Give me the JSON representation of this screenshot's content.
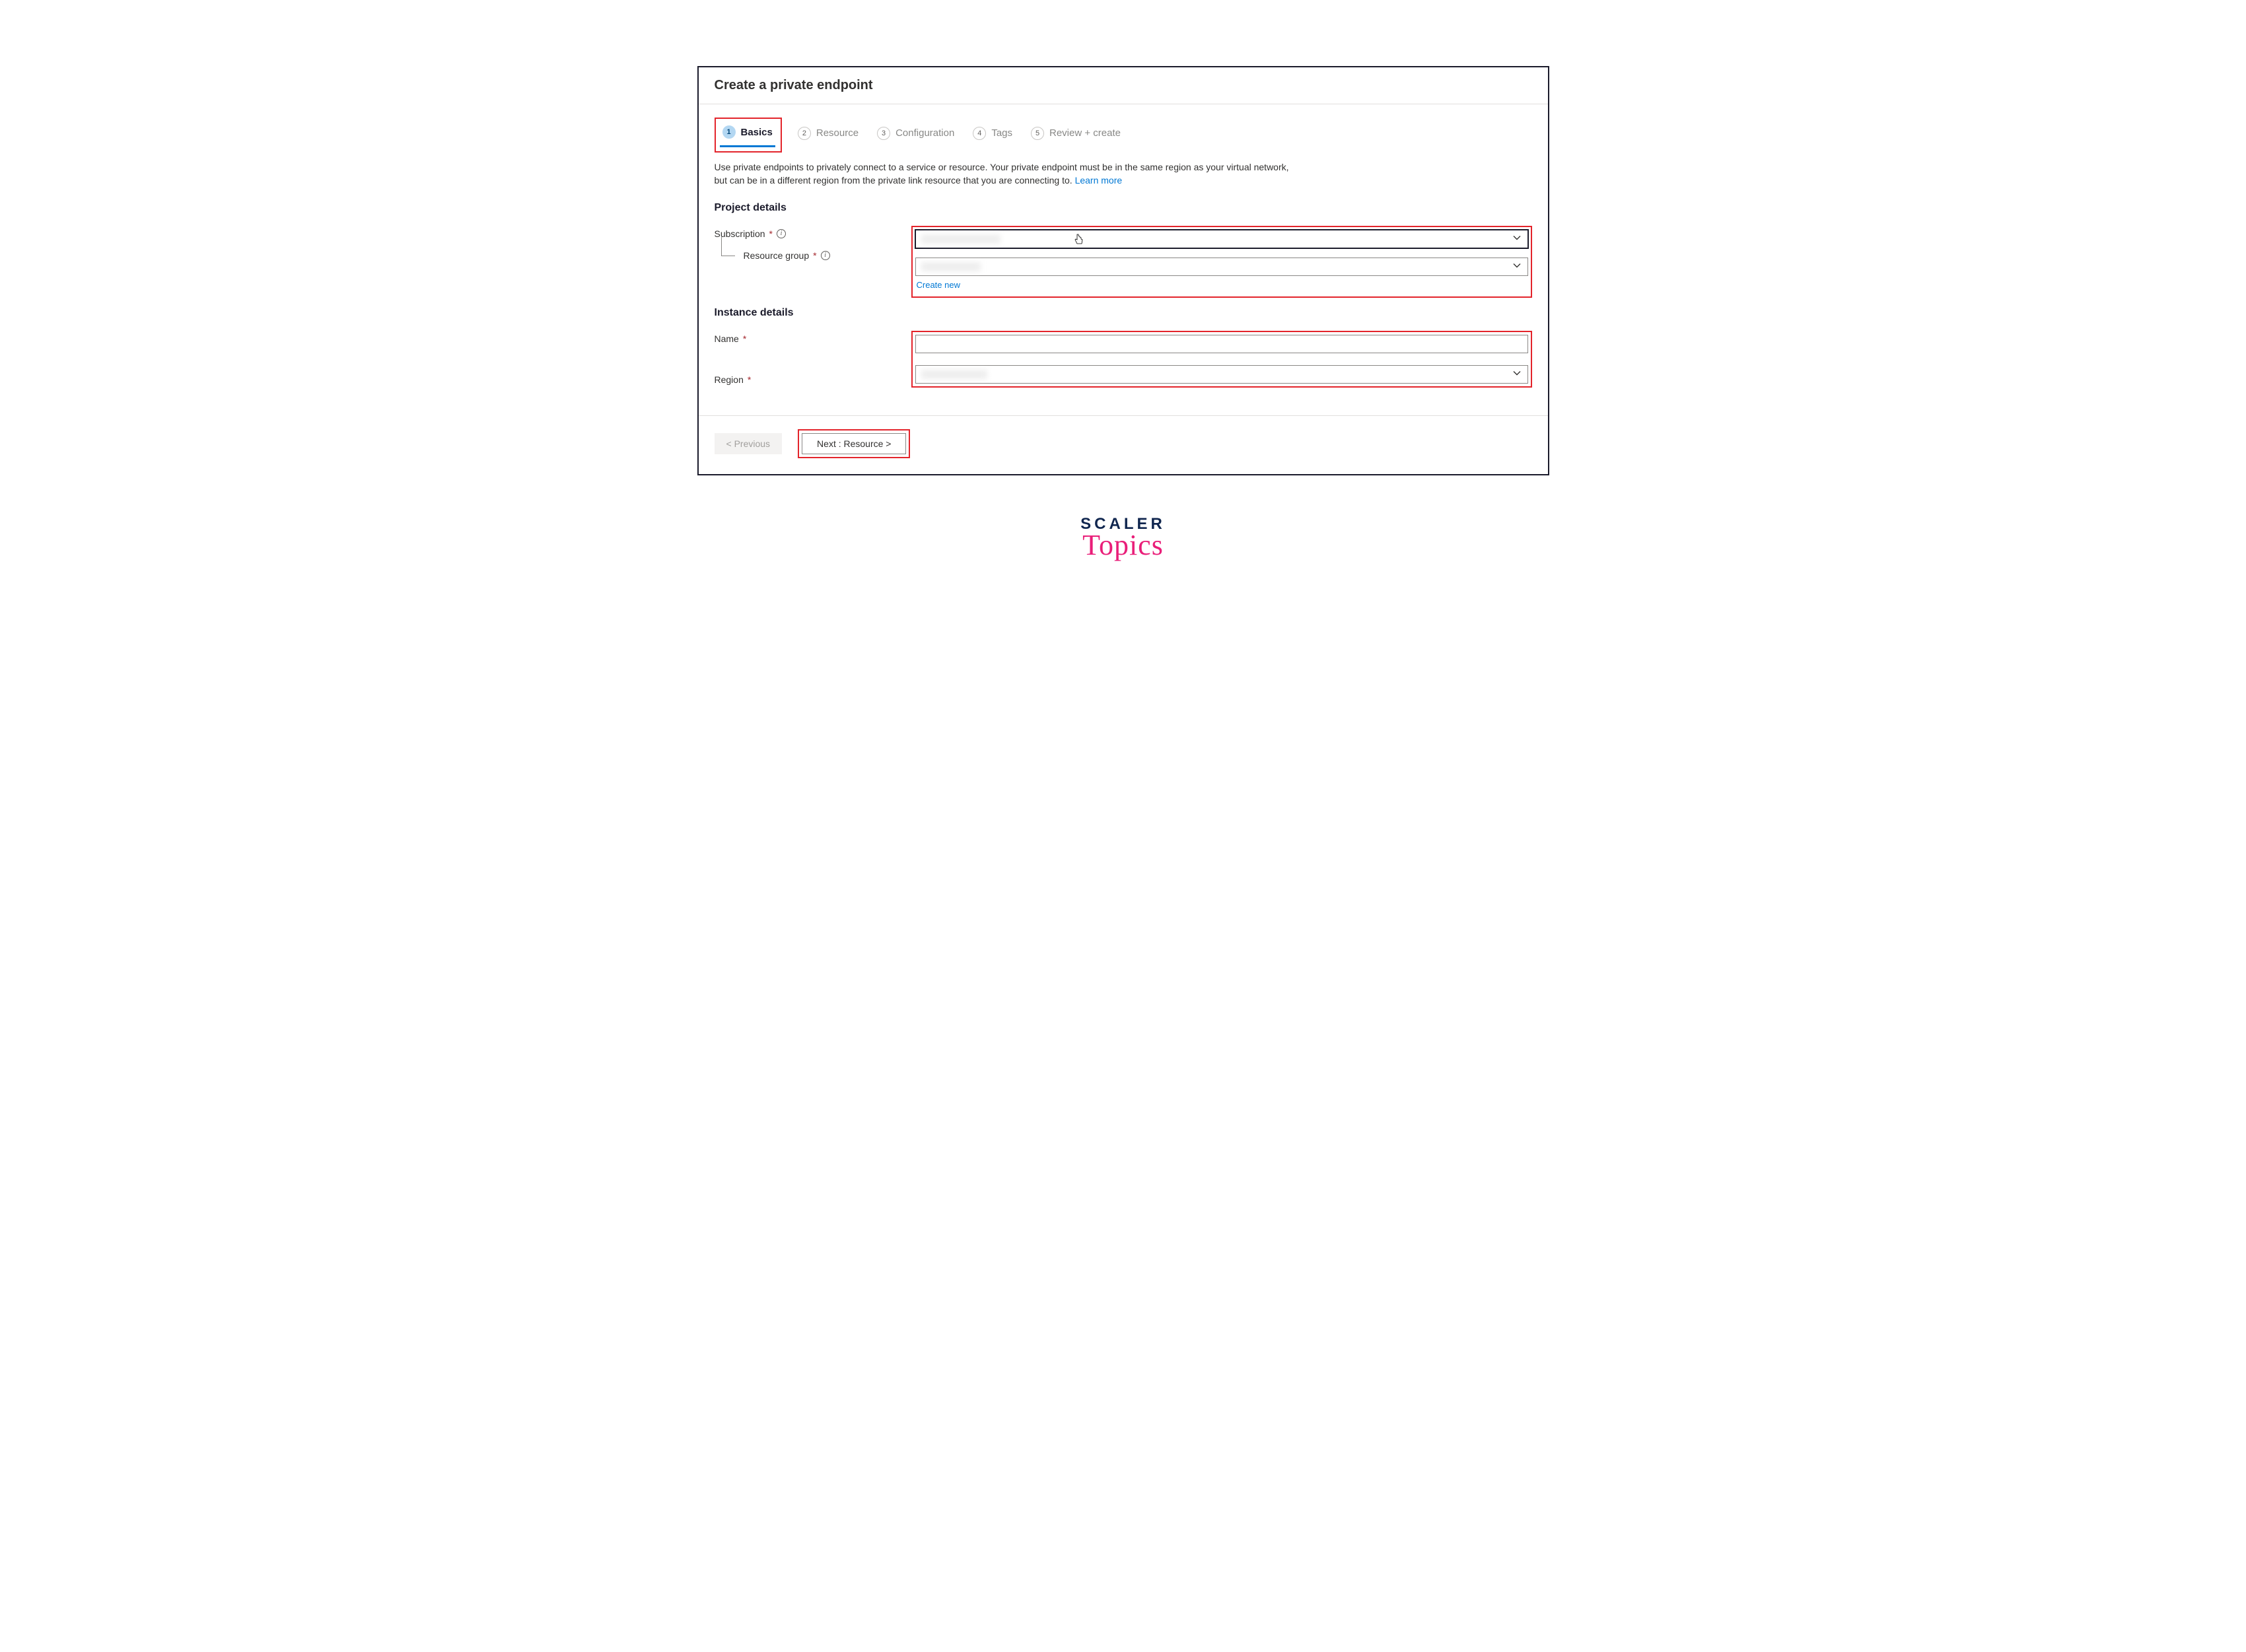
{
  "header": {
    "title": "Create a private endpoint"
  },
  "tabs": [
    {
      "num": "1",
      "label": "Basics",
      "active": true
    },
    {
      "num": "2",
      "label": "Resource"
    },
    {
      "num": "3",
      "label": "Configuration"
    },
    {
      "num": "4",
      "label": "Tags"
    },
    {
      "num": "5",
      "label": "Review + create"
    }
  ],
  "description": {
    "text": "Use private endpoints to privately connect to a service or resource. Your private endpoint must be in the same region as your virtual network, but can be in a different region from the private link resource that you are connecting to.  ",
    "learn_more": "Learn more"
  },
  "sections": {
    "project": {
      "heading": "Project details",
      "subscription_label": "Subscription",
      "resource_group_label": "Resource group",
      "create_new": "Create new"
    },
    "instance": {
      "heading": "Instance details",
      "name_label": "Name",
      "region_label": "Region"
    }
  },
  "footer": {
    "previous": "< Previous",
    "next": "Next : Resource >"
  },
  "brand": {
    "line1": "SCALER",
    "line2": "Topics"
  }
}
